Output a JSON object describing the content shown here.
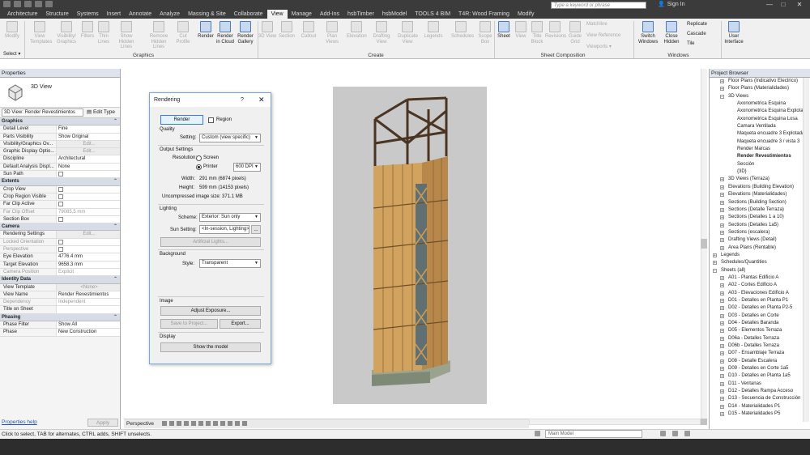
{
  "ribbon_tabs": [
    "Architecture",
    "Structure",
    "Systems",
    "Insert",
    "Annotate",
    "Analyze",
    "Massing & Site",
    "Collaborate",
    "View",
    "Manage",
    "Add-Ins",
    "hsbTimber",
    "hsbModel",
    "TOOLS 4 BIM",
    "T4R: Wood Framing",
    "Modify"
  ],
  "active_tab": "View",
  "search_placeholder": "Type a keyword or phrase",
  "sign_in": "Sign In",
  "window_controls": {
    "minimize": "—",
    "maximize": "□",
    "close": "✕"
  },
  "ribbon": {
    "modify": "Modify",
    "select": "Select ▾",
    "graphics_label": "Graphics",
    "create_label": "Create",
    "sheet_label": "Sheet Composition",
    "windows_label": "Windows",
    "buttons": {
      "view_templates": "View Templates",
      "visibility_graphics": "Visibility/ Graphics",
      "filters": "Filters",
      "thin_lines": "Thin Lines",
      "show_hidden": "Show Hidden Lines",
      "remove_hidden": "Remove Hidden Lines",
      "cut_profile": "Cut Profile",
      "render": "Render",
      "render_cloud": "Render in Cloud",
      "render_gallery": "Render Gallery",
      "3d_view": "3D View",
      "section": "Section",
      "callout": "Callout",
      "plan_views": "Plan Views",
      "elevation": "Elevation",
      "drafting_view": "Drafting View",
      "duplicate_view": "Duplicate View",
      "legends": "Legends",
      "schedules": "Schedules",
      "scope_box": "Scope Box",
      "sheet": "Sheet",
      "view": "View",
      "title_block": "Title Block",
      "revisions": "Revisions",
      "guide_grid": "Guide Grid",
      "switch_windows": "Switch Windows",
      "close_hidden": "Close Hidden",
      "user_interface": "User Interface"
    },
    "small": {
      "matchline": "Matchline",
      "view_reference": "View Reference",
      "viewports": "Viewports ▾",
      "replicate": "Replicate",
      "cascade": "Cascade",
      "tile": "Tile"
    }
  },
  "properties": {
    "title": "Properties",
    "type_name": "3D View",
    "view_selector": "3D View: Render Revestimientos",
    "edit_type": "Edit Type",
    "groups": [
      {
        "name": "Graphics",
        "rows": [
          {
            "k": "Detail Level",
            "v": "Fine"
          },
          {
            "k": "Parts Visibility",
            "v": "Show Original"
          },
          {
            "k": "Visibility/Graphics Ov...",
            "v": "Edit...",
            "btn": true
          },
          {
            "k": "Graphic Display Optio...",
            "v": "Edit...",
            "btn": true
          },
          {
            "k": "Discipline",
            "v": "Architectural"
          },
          {
            "k": "Default Analysis Displ...",
            "v": "None"
          },
          {
            "k": "Sun Path",
            "v": "",
            "check": true
          }
        ]
      },
      {
        "name": "Extents",
        "rows": [
          {
            "k": "Crop View",
            "v": "",
            "check": true
          },
          {
            "k": "Crop Region Visible",
            "v": "",
            "check": true
          },
          {
            "k": "Far Clip Active",
            "v": "",
            "check": true
          },
          {
            "k": "Far Clip Offset",
            "v": "79085.5 mm",
            "dim": true
          },
          {
            "k": "Section Box",
            "v": "",
            "check": true
          }
        ]
      },
      {
        "name": "Camera",
        "rows": [
          {
            "k": "Rendering Settings",
            "v": "Edit...",
            "btn": true
          },
          {
            "k": "Locked Orientation",
            "v": "",
            "check": true,
            "dim": true
          },
          {
            "k": "Perspective",
            "v": "",
            "check": true,
            "dim": true
          },
          {
            "k": "Eye Elevation",
            "v": "4776.4 mm"
          },
          {
            "k": "Target Elevation",
            "v": "9658.3 mm"
          },
          {
            "k": "Camera Position",
            "v": "Explicit",
            "dim": true
          }
        ]
      },
      {
        "name": "Identity Data",
        "rows": [
          {
            "k": "View Template",
            "v": "<None>",
            "btn": true
          },
          {
            "k": "View Name",
            "v": "Render Revestimientos"
          },
          {
            "k": "Dependency",
            "v": "Independent",
            "dim": true
          },
          {
            "k": "Title on Sheet",
            "v": ""
          }
        ]
      },
      {
        "name": "Phasing",
        "rows": [
          {
            "k": "Phase Filter",
            "v": "Show All"
          },
          {
            "k": "Phase",
            "v": "New Construction"
          }
        ]
      }
    ],
    "help": "Properties help",
    "apply": "Apply"
  },
  "rendering_dialog": {
    "title": "Rendering",
    "help": "?",
    "close": "✕",
    "render_btn": "Render",
    "region": "Region",
    "quality": "Quality",
    "setting_label": "Setting:",
    "quality_setting": "Custom (view specific)",
    "output_settings": "Output Settings",
    "resolution_label": "Resolution:",
    "screen": "Screen",
    "printer": "Printer",
    "dpi": "600 DPI",
    "width_label": "Width:",
    "width_value": "291 mm (6874 pixels)",
    "height_label": "Height:",
    "height_value": "599 mm (14153 pixels)",
    "uncompressed": "Uncompressed image size:  371.1 MB",
    "lighting": "Lighting",
    "scheme_label": "Scheme:",
    "scheme_value": "Exterior: Sun only",
    "sun_label": "Sun Setting:",
    "sun_value": "<In-session, Lighting>",
    "sun_browse": "...",
    "artificial": "Artificial Lights...",
    "background": "Background",
    "style_label": "Style:",
    "style_value": "Transparent",
    "image": "Image",
    "adjust_exposure": "Adjust Exposure...",
    "save_project": "Save to Project...",
    "export": "Export...",
    "display": "Display",
    "show_model": "Show the model"
  },
  "view_control": {
    "mode": "Perspective"
  },
  "browser": {
    "title": "Project Browser",
    "items": [
      {
        "t": "Floor Plans (Indicativo Electrico)",
        "l": 1,
        "tog": "+"
      },
      {
        "t": "Floor Plans (Materialidades)",
        "l": 1,
        "tog": "+"
      },
      {
        "t": "3D Views",
        "l": 1,
        "tog": "−"
      },
      {
        "t": "Axonometrica Esquina",
        "l": 2
      },
      {
        "t": "Axonometrica Esquina Explotada",
        "l": 2
      },
      {
        "t": "Axonometrica Esquina Losa",
        "l": 2
      },
      {
        "t": "Camara Ventilada",
        "l": 2
      },
      {
        "t": "Maqueta encuadre 3 Explotada",
        "l": 2
      },
      {
        "t": "Maqueta encuadre 3 / vista 3",
        "l": 2
      },
      {
        "t": "Render Marcas",
        "l": 2
      },
      {
        "t": "Render Revestimientos",
        "l": 2,
        "bold": true
      },
      {
        "t": "Sección",
        "l": 2
      },
      {
        "t": "{3D}",
        "l": 2
      },
      {
        "t": "3D Views (Terraza)",
        "l": 1,
        "tog": "+"
      },
      {
        "t": "Elevations (Building Elevation)",
        "l": 1,
        "tog": "+"
      },
      {
        "t": "Elevations (Materialidades)",
        "l": 1,
        "tog": "+"
      },
      {
        "t": "Sections (Building Section)",
        "l": 1,
        "tog": "+"
      },
      {
        "t": "Sections (Detalle Terraza)",
        "l": 1,
        "tog": "+"
      },
      {
        "t": "Sections (Detalles 1 a 10)",
        "l": 1,
        "tog": "+"
      },
      {
        "t": "Sections (Detalles 1a5)",
        "l": 1,
        "tog": "+"
      },
      {
        "t": "Sections (escalera)",
        "l": 1,
        "tog": "+"
      },
      {
        "t": "Drafting Views (Detail)",
        "l": 1,
        "tog": "+"
      },
      {
        "t": "Area Plans (Rentable)",
        "l": 1,
        "tog": "+"
      },
      {
        "t": "Legends",
        "l": 0,
        "tog": "+"
      },
      {
        "t": "Schedules/Quantities",
        "l": 0,
        "tog": "+"
      },
      {
        "t": "Sheets (all)",
        "l": 0,
        "tog": "−"
      },
      {
        "t": "A01 - Plantas Edificio A",
        "l": 1,
        "tog": "+"
      },
      {
        "t": "A02 - Cortes Edificio A",
        "l": 1,
        "tog": "+"
      },
      {
        "t": "A03 - Elevaciones Edificio A",
        "l": 1,
        "tog": "+"
      },
      {
        "t": "D01 - Detalles en Planta P1",
        "l": 1,
        "tog": "+"
      },
      {
        "t": "D02 - Detalles en Planta P2-5",
        "l": 1,
        "tog": "+"
      },
      {
        "t": "D03 - Detalles en Corte",
        "l": 1,
        "tog": "+"
      },
      {
        "t": "D04 - Detalles Baranda",
        "l": 1,
        "tog": "+"
      },
      {
        "t": "D05 - Elementos Terraza",
        "l": 1,
        "tog": "+"
      },
      {
        "t": "D06a - Detalles Terraza",
        "l": 1,
        "tog": "+"
      },
      {
        "t": "D06b - Detalles Terraza",
        "l": 1,
        "tog": "+"
      },
      {
        "t": "D07 - Ensamblaje Terraza",
        "l": 1,
        "tog": "+"
      },
      {
        "t": "D08 - Detalle Escalera",
        "l": 1,
        "tog": "+"
      },
      {
        "t": "D09 - Detalles en Corte 1a5",
        "l": 1,
        "tog": "+"
      },
      {
        "t": "D10 - Detalles en Planta 1a5",
        "l": 1,
        "tog": "+"
      },
      {
        "t": "D11 - Ventanas",
        "l": 1,
        "tog": "+"
      },
      {
        "t": "D12 - Detalles Rampa Acceso",
        "l": 1,
        "tog": "+"
      },
      {
        "t": "D13 - Secuencia de Construcción",
        "l": 1,
        "tog": "+"
      },
      {
        "t": "D14 - Materialidades P1",
        "l": 1,
        "tog": "+"
      },
      {
        "t": "D15 - Materialidades P5",
        "l": 1,
        "tog": "+"
      }
    ]
  },
  "status": {
    "text": "Click to select, TAB for alternates, CTRL adds, SHIFT unselects.",
    "model": "Main Model"
  },
  "colors": {
    "accent": "#4a7ab8",
    "wood": "#d2a35f",
    "frame": "#4a3422"
  }
}
